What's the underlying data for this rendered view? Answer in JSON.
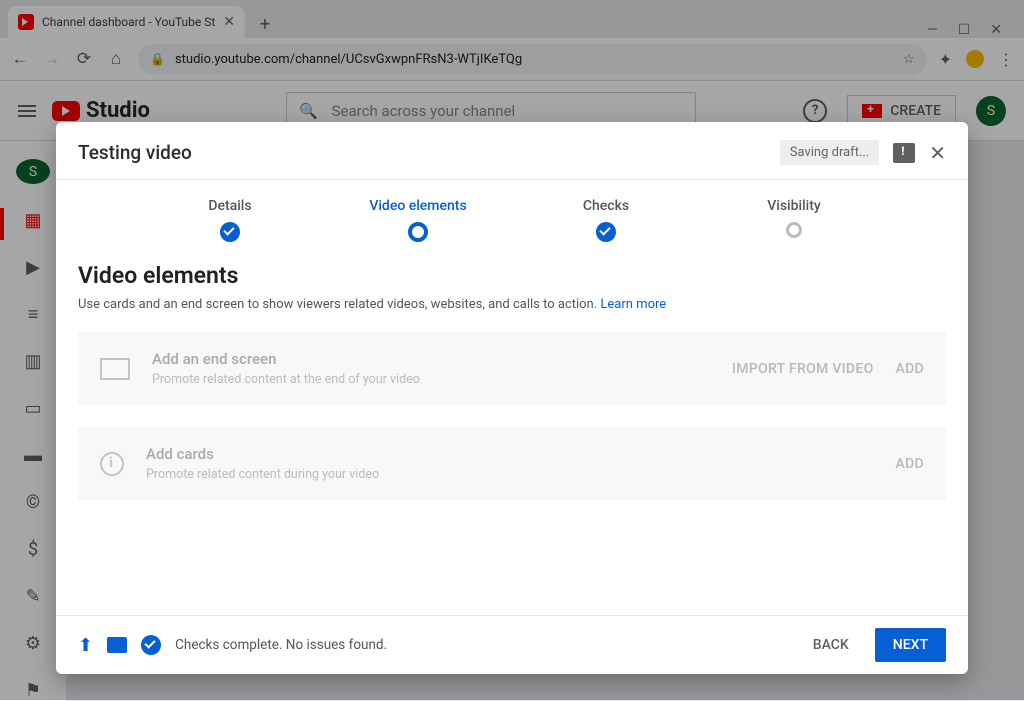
{
  "browser": {
    "tab_title": "Channel dashboard - YouTube St",
    "url": "studio.youtube.com/channel/UCsvGxwpnFRsN3-WTjIKeTQg"
  },
  "header": {
    "logo_text": "Studio",
    "search_placeholder": "Search across your channel",
    "create_label": "CREATE",
    "avatar_initial": "S"
  },
  "sidebar": {
    "avatar_initial": "S"
  },
  "dialog": {
    "title": "Testing video",
    "saving_label": "Saving draft...",
    "steps": [
      {
        "label": "Details"
      },
      {
        "label": "Video elements"
      },
      {
        "label": "Checks"
      },
      {
        "label": "Visibility"
      }
    ],
    "section": {
      "title": "Video elements",
      "description": "Use cards and an end screen to show viewers related videos, websites, and calls to action.",
      "learn_more": "Learn more"
    },
    "cards": [
      {
        "title": "Add an end screen",
        "subtitle": "Promote related content at the end of your video",
        "import_label": "IMPORT FROM VIDEO",
        "add_label": "ADD"
      },
      {
        "title": "Add cards",
        "subtitle": "Promote related content during your video",
        "add_label": "ADD"
      }
    ],
    "footer": {
      "status": "Checks complete. No issues found.",
      "back_label": "BACK",
      "next_label": "NEXT"
    }
  }
}
